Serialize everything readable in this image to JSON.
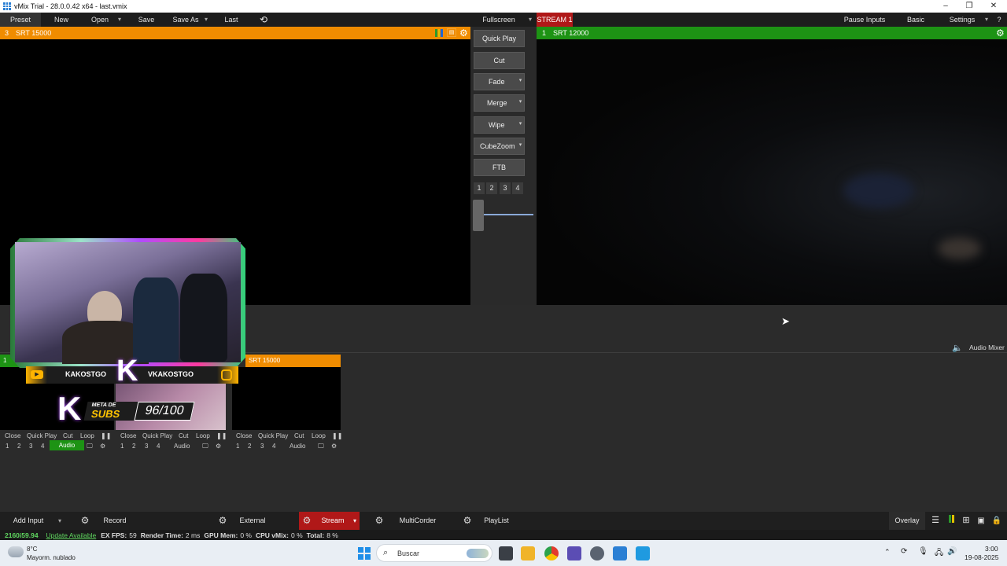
{
  "window": {
    "title": "vMix Trial - 28.0.0.42 x64 - last.vmix",
    "minimize": "–",
    "restore": "❐",
    "close": "✕"
  },
  "menu": {
    "preset": "Preset",
    "new": "New",
    "open": "Open",
    "save": "Save",
    "save_as": "Save As",
    "last": "Last",
    "fullscreen": "Fullscreen",
    "stream_badge": "STREAM 1",
    "pause_inputs": "Pause Inputs",
    "basic": "Basic",
    "settings": "Settings",
    "help": "?"
  },
  "preview": {
    "number": "3",
    "name": "SRT  15000"
  },
  "program": {
    "number": "1",
    "name": "SRT  12000"
  },
  "transitions": {
    "quick_play": "Quick Play",
    "cut": "Cut",
    "fade": "Fade",
    "merge": "Merge",
    "wipe": "Wipe",
    "cubezoom": "CubeZoom",
    "ftb": "FTB",
    "numbers": [
      "1",
      "2",
      "3",
      "4"
    ]
  },
  "overlay": {
    "left_name": "KAKOSTGO",
    "right_name": "VKAKOSTGO",
    "meta_line1": "META DE",
    "meta_line2": "SUBS",
    "counter": "96/100"
  },
  "audio_mixer": "Audio Mixer",
  "inputs": [
    {
      "number": "1",
      "name": "",
      "controls": [
        "Close",
        "Quick Play",
        "Cut",
        "Loop"
      ],
      "nums": [
        "1",
        "2",
        "3",
        "4"
      ],
      "audio": "Audio",
      "audio_active": true
    },
    {
      "number": "",
      "name": "SRT  15000",
      "controls": [
        "Close",
        "Quick Play",
        "Cut",
        "Loop"
      ],
      "nums": [
        "1",
        "2",
        "3",
        "4"
      ],
      "audio": "Audio",
      "audio_active": false
    },
    {
      "number": "",
      "name": "",
      "controls": [
        "Close",
        "Quick Play",
        "Cut",
        "Loop"
      ],
      "nums": [
        "1",
        "2",
        "3",
        "4"
      ],
      "audio": "Audio",
      "audio_active": false
    }
  ],
  "bottombar": {
    "add_input": "Add Input",
    "record": "Record",
    "external": "External",
    "stream": "Stream",
    "multicorder": "MultiCorder",
    "playlist": "PlayList",
    "overlay": "Overlay"
  },
  "status": {
    "resolution": "2160i59.94",
    "update": "Update Available",
    "ex_fps_label": "EX FPS:",
    "ex_fps": "59",
    "render_label": "Render Time:",
    "render": "2 ms",
    "gpu_label": "GPU Mem:",
    "gpu": "0 %",
    "cpu_label": "CPU vMix:",
    "cpu": "0 %",
    "total_label": "Total:",
    "total": "8 %"
  },
  "taskbar": {
    "temp": "8°C",
    "weather": "Mayorm. nublado",
    "search": "Buscar",
    "time": "3:00",
    "date": "19-08-2025"
  },
  "colors": {
    "preview": "#f08c00",
    "program": "#1d9314",
    "stream_red": "#b01818",
    "status_green": "#5fd65f"
  }
}
